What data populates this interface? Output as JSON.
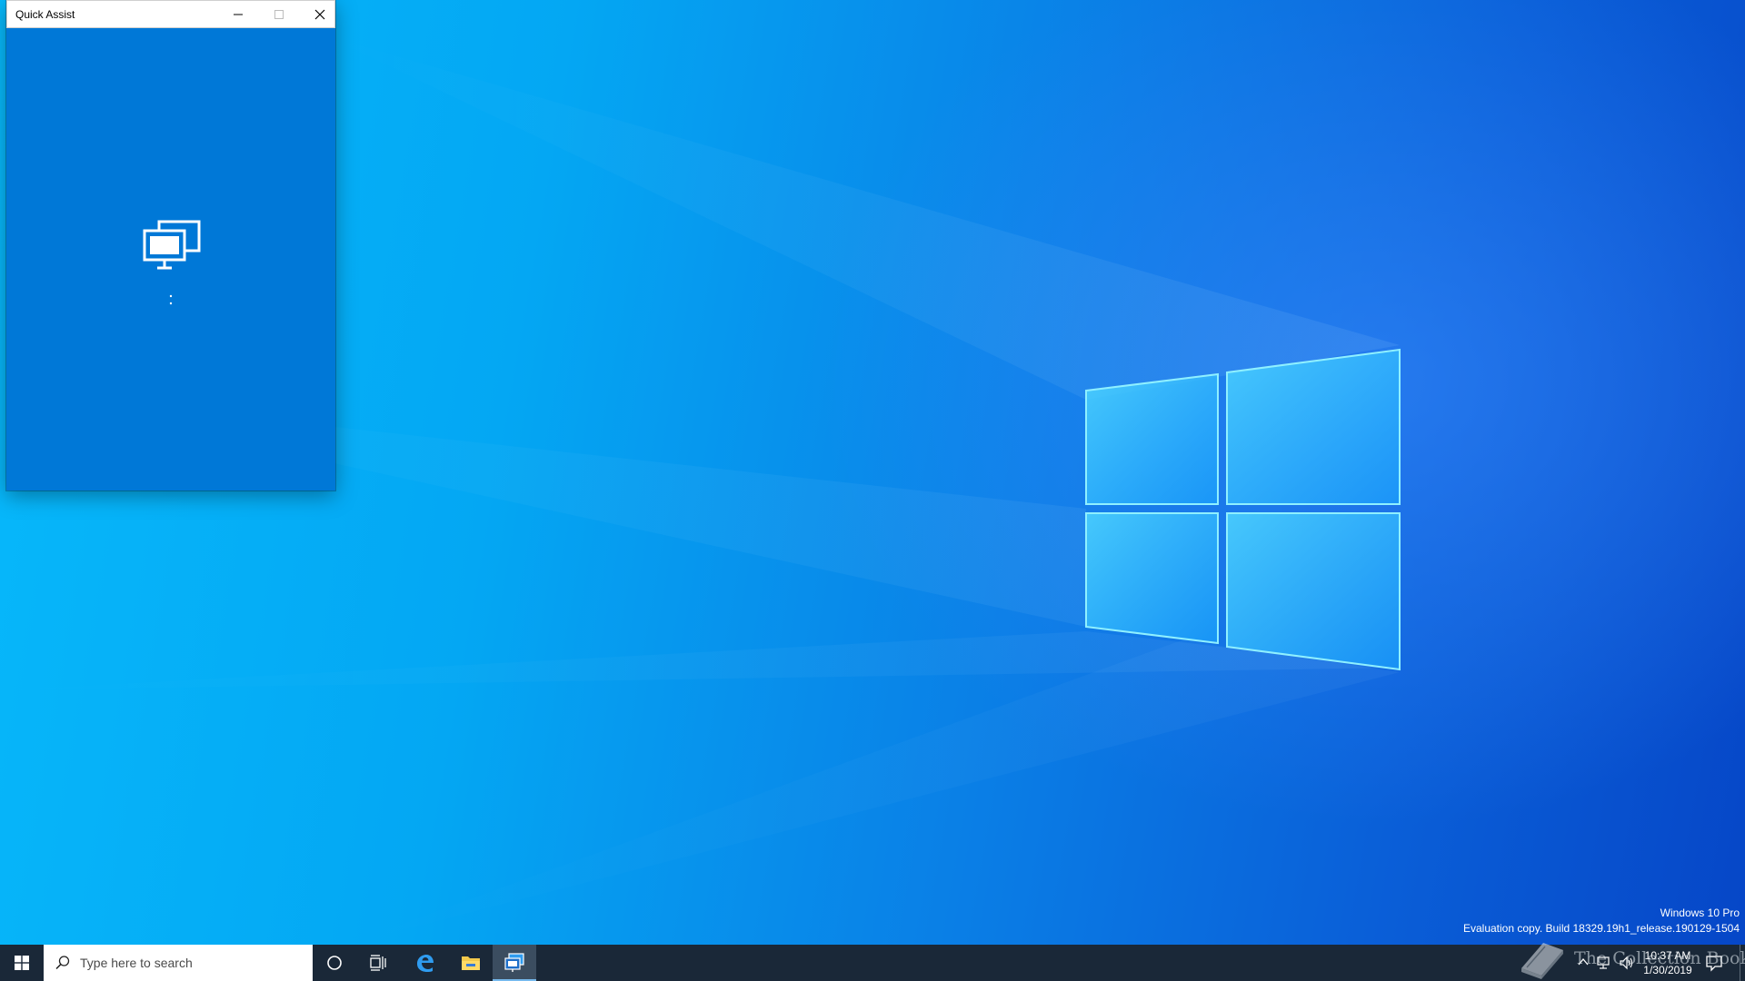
{
  "colors": {
    "window_accent": "#0078d7",
    "taskbar": "#1a2838",
    "active_taskbar_item": "#3b4d60",
    "active_indicator": "#76b9ed"
  },
  "quick_assist": {
    "title": "Quick Assist",
    "minimize_icon": "minimize-icon",
    "maximize_icon": "maximize-icon",
    "close_icon": "close-icon",
    "body_icon": "remote-desktop-icon",
    "status": "loading-spinner"
  },
  "watermark": {
    "edition": "Windows 10 Pro",
    "build": "Evaluation copy. Build 18329.19h1_release.190129-1504"
  },
  "taskbar": {
    "start_icon": "windows-logo-icon",
    "search_placeholder": "Type here to search",
    "pinned": [
      "cortana-icon",
      "task-view-icon",
      "edge-icon",
      "file-explorer-icon",
      "quick-assist-icon"
    ],
    "active_app": "Quick Assist"
  },
  "tray": {
    "time": "10:37 AM",
    "date": "1/30/2019",
    "icons": [
      "chevron-up-icon",
      "network-icon",
      "volume-icon",
      "notification-icon"
    ]
  },
  "brand": {
    "text": "The Collection Book"
  }
}
